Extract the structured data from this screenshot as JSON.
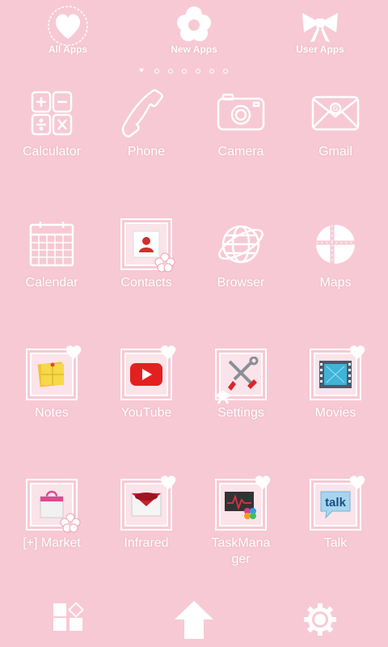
{
  "top_tabs": [
    {
      "label": "All Apps",
      "icon": "heart-icon"
    },
    {
      "label": "New Apps",
      "icon": "flower-icon"
    },
    {
      "label": "User Apps",
      "icon": "ribbon-bow-icon"
    }
  ],
  "page_indicator": {
    "count": 7,
    "current": 1
  },
  "apps": [
    {
      "label": "Calculator",
      "icon": "calculator-icon"
    },
    {
      "label": "Phone",
      "icon": "phone-icon"
    },
    {
      "label": "Camera",
      "icon": "camera-icon"
    },
    {
      "label": "Gmail",
      "icon": "gmail-icon"
    },
    {
      "label": "Calendar",
      "icon": "calendar-icon"
    },
    {
      "label": "Contacts",
      "icon": "contacts-icon"
    },
    {
      "label": "Browser",
      "icon": "globe-icon"
    },
    {
      "label": "Maps",
      "icon": "maps-icon"
    },
    {
      "label": "Notes",
      "icon": "notes-icon"
    },
    {
      "label": "YouTube",
      "icon": "youtube-icon"
    },
    {
      "label": "Settings",
      "icon": "settings-tools-icon"
    },
    {
      "label": "Movies",
      "icon": "movies-icon"
    },
    {
      "label": "[+] Market",
      "icon": "market-bag-icon"
    },
    {
      "label": "Infrared",
      "icon": "infrared-icon"
    },
    {
      "label": "TaskManager",
      "icon": "task-manager-icon"
    },
    {
      "label": "Talk",
      "icon": "talk-icon"
    }
  ],
  "dock": [
    {
      "icon": "app-drawer-icon"
    },
    {
      "icon": "home-arrow-icon"
    },
    {
      "icon": "gear-icon"
    }
  ],
  "colors": {
    "background": "#f7c9d5",
    "foreground": "#ffffff",
    "youtube_red": "#e32020"
  },
  "talk_icon_text": "talk"
}
